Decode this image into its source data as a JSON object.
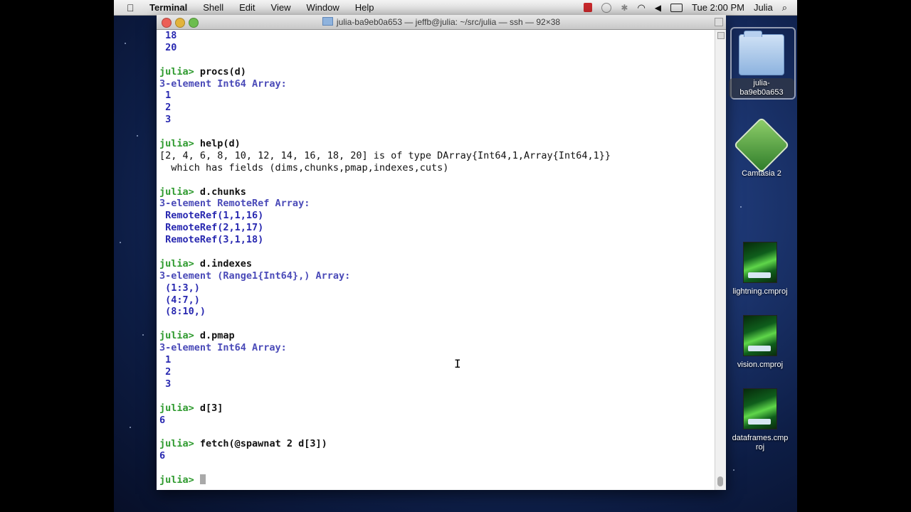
{
  "menubar": {
    "app_name": "Terminal",
    "menus": [
      "Shell",
      "Edit",
      "View",
      "Window",
      "Help"
    ],
    "clock": "Tue 2:00 PM",
    "user": "Julia"
  },
  "window": {
    "title": "julia-ba9eb0a653 — jeffb@julia: ~/src/julia — ssh — 92×38"
  },
  "terminal": {
    "lines": [
      {
        "kind": "val",
        "text": " 18"
      },
      {
        "kind": "val",
        "text": " 20"
      },
      {
        "kind": "blank",
        "text": ""
      },
      {
        "kind": "cmd",
        "prompt": "julia> ",
        "text": "procs(d)"
      },
      {
        "kind": "type",
        "text": "3-element Int64 Array:"
      },
      {
        "kind": "val",
        "text": " 1"
      },
      {
        "kind": "val",
        "text": " 2"
      },
      {
        "kind": "val",
        "text": " 3"
      },
      {
        "kind": "blank",
        "text": ""
      },
      {
        "kind": "cmd",
        "prompt": "julia> ",
        "text": "help(d)"
      },
      {
        "kind": "plain",
        "text": "[2, 4, 6, 8, 10, 12, 14, 16, 18, 20] is of type DArray{Int64,1,Array{Int64,1}}"
      },
      {
        "kind": "plain",
        "text": "  which has fields (dims,chunks,pmap,indexes,cuts)"
      },
      {
        "kind": "blank",
        "text": ""
      },
      {
        "kind": "cmd",
        "prompt": "julia> ",
        "text": "d.chunks"
      },
      {
        "kind": "type",
        "text": "3-element RemoteRef Array:"
      },
      {
        "kind": "val",
        "text": " RemoteRef(1,1,16)"
      },
      {
        "kind": "val",
        "text": " RemoteRef(2,1,17)"
      },
      {
        "kind": "val",
        "text": " RemoteRef(3,1,18)"
      },
      {
        "kind": "blank",
        "text": ""
      },
      {
        "kind": "cmd",
        "prompt": "julia> ",
        "text": "d.indexes"
      },
      {
        "kind": "type",
        "text": "3-element (Range1{Int64},) Array:"
      },
      {
        "kind": "val",
        "text": " (1:3,)"
      },
      {
        "kind": "val",
        "text": " (4:7,)"
      },
      {
        "kind": "val",
        "text": " (8:10,)"
      },
      {
        "kind": "blank",
        "text": ""
      },
      {
        "kind": "cmd",
        "prompt": "julia> ",
        "text": "d.pmap"
      },
      {
        "kind": "type",
        "text": "3-element Int64 Array:"
      },
      {
        "kind": "val",
        "text": " 1"
      },
      {
        "kind": "val",
        "text": " 2"
      },
      {
        "kind": "val",
        "text": " 3"
      },
      {
        "kind": "blank",
        "text": ""
      },
      {
        "kind": "cmd",
        "prompt": "julia> ",
        "text": "d[3]"
      },
      {
        "kind": "val",
        "text": "6"
      },
      {
        "kind": "blank",
        "text": ""
      },
      {
        "kind": "cmd",
        "prompt": "julia> ",
        "text": "fetch(@spawnat 2 d[3])"
      },
      {
        "kind": "val",
        "text": "6"
      },
      {
        "kind": "blank",
        "text": ""
      },
      {
        "kind": "cursor",
        "prompt": "julia> ",
        "text": ""
      }
    ]
  },
  "desktop_icons": [
    {
      "name": "folder",
      "label": "julia-ba9eb0a653",
      "icon": "folder-icon"
    },
    {
      "name": "camtasia",
      "label": "Camtasia 2",
      "icon": "camtasia-icon"
    },
    {
      "name": "lightning",
      "label": "lightning.cmproj",
      "icon": "cmproj-icon"
    },
    {
      "name": "vision",
      "label": "vision.cmproj",
      "icon": "cmproj-icon"
    },
    {
      "name": "dataframes",
      "label": "dataframes.cmproj",
      "icon": "cmproj-icon"
    }
  ],
  "colors": {
    "prompt": "#2e9a2e",
    "output_type": "#4a4ab8",
    "output_value": "#2828b0"
  }
}
